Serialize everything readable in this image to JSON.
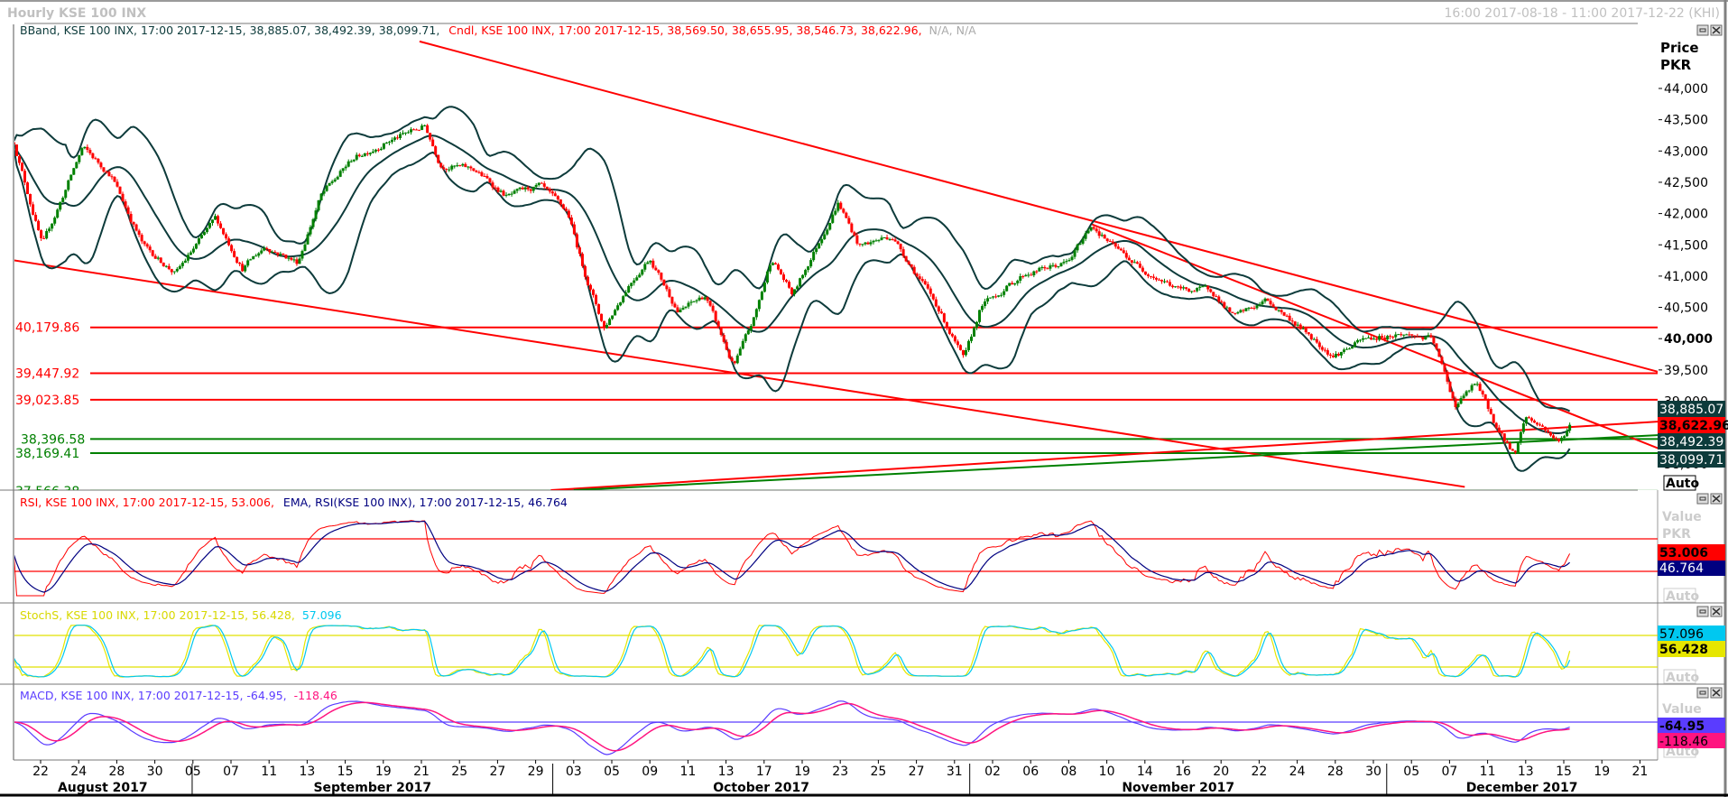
{
  "window": {
    "title": "Hourly KSE 100 INX",
    "range": "16:00 2017-08-18 - 11:00 2017-12-22 (KHI)"
  },
  "main_panel": {
    "legend_bband": "BBand, KSE 100 INX, 17:00 2017-12-15, 38,885.07, 38,492.39, 38,099.71,",
    "legend_cndl": "Cndl, KSE 100 INX, 17:00 2017-12-15, 38,569.50, 38,655.95, 38,546.73, 38,622.96,",
    "legend_na": "N/A, N/A",
    "axis_title": "Price",
    "axis_unit": "PKR",
    "auto": "Auto",
    "value_labels": {
      "bb_upper": "38,885.07",
      "close": "38,622.96",
      "bb_mid": "38,492.39",
      "bb_lower": "38,099.71"
    },
    "horizontal_levels": [
      {
        "label": "40,179.86",
        "value": 40179.86,
        "color": "#ff0000"
      },
      {
        "label": "39,447.92",
        "value": 39447.92,
        "color": "#ff0000"
      },
      {
        "label": "39,023.85",
        "value": 39023.85,
        "color": "#ff0000"
      },
      {
        "label": "38,396.58",
        "value": 38396.58,
        "color": "#008000"
      },
      {
        "label": "38,169.41",
        "value": 38169.41,
        "color": "#008000"
      },
      {
        "label": "37,566.38",
        "value": 37566.38,
        "color": "#008000"
      }
    ]
  },
  "rsi_panel": {
    "legend_rsi": "RSI, KSE 100 INX, 17:00 2017-12-15, 53.006,",
    "legend_ema": "EMA, RSI(KSE 100 INX), 17:00 2017-12-15, 46.764",
    "axis_title": "Value",
    "axis_unit": "PKR",
    "rsi_value": "53.006",
    "ema_value": "46.764",
    "auto": "Auto"
  },
  "stoch_panel": {
    "legend_k": "StochS, KSE 100 INX, 17:00 2017-12-15, 56.428,",
    "legend_d": "57.096",
    "d_value": "57.096",
    "k_value": "56.428",
    "auto": "Auto"
  },
  "macd_panel": {
    "legend_macd": "MACD, KSE 100 INX, 17:00 2017-12-15, -64.95,",
    "legend_signal": "-118.46",
    "axis_title": "Value",
    "macd_value": "-64.95",
    "signal_value": "-118.46",
    "auto": "Auto"
  },
  "colors": {
    "up": "#008000",
    "down": "#ff0000",
    "bands": "#0d3b3b",
    "rsi": "#ff0000",
    "rsi_ema": "#000080",
    "stoch_k": "#e6e600",
    "stoch_d": "#00c8f0",
    "macd": "#5a3cff",
    "signal": "#ff1480"
  },
  "chart_data": {
    "type": "candlestick",
    "title": "Hourly KSE 100 INX",
    "x_unit": "trading days from 2017-08-22",
    "ylabel": "Price PKR",
    "ylim": [
      37566,
      44800
    ],
    "yticks": [
      "44,000",
      "43,500",
      "43,000",
      "42,500",
      "42,000",
      "41,500",
      "41,000",
      "40,500",
      "40,000",
      "39,500",
      "39,000",
      "38,500",
      "38,000"
    ],
    "bars_per_day": 7,
    "close_path": [
      [
        -1.4,
        43140
      ],
      [
        0.1,
        41480
      ],
      [
        2.2,
        43055
      ],
      [
        3.7,
        42620
      ],
      [
        5.4,
        41480
      ],
      [
        7.1,
        41040
      ],
      [
        9.2,
        41920
      ],
      [
        10.6,
        41130
      ],
      [
        11.8,
        41480
      ],
      [
        13.5,
        41220
      ],
      [
        14.7,
        42270
      ],
      [
        16.4,
        42880
      ],
      [
        18.1,
        43140
      ],
      [
        20.2,
        43400
      ],
      [
        21.0,
        42790
      ],
      [
        22.8,
        42700
      ],
      [
        24.5,
        42270
      ],
      [
        26.2,
        42440
      ],
      [
        27.7,
        42000
      ],
      [
        28.5,
        41130
      ],
      [
        29.6,
        40170
      ],
      [
        30.9,
        40870
      ],
      [
        32.0,
        41300
      ],
      [
        33.5,
        40430
      ],
      [
        34.9,
        40690
      ],
      [
        36.4,
        39550
      ],
      [
        37.5,
        40340
      ],
      [
        38.4,
        41300
      ],
      [
        39.5,
        40690
      ],
      [
        41.9,
        42180
      ],
      [
        43.0,
        41480
      ],
      [
        44.7,
        41650
      ],
      [
        47.1,
        40520
      ],
      [
        48.5,
        39640
      ],
      [
        49.4,
        40520
      ],
      [
        51.7,
        41040
      ],
      [
        54.0,
        41220
      ],
      [
        55.2,
        41830
      ],
      [
        56.3,
        41480
      ],
      [
        57.8,
        41130
      ],
      [
        59.8,
        40780
      ],
      [
        61.5,
        40780
      ],
      [
        62.7,
        40340
      ],
      [
        64.4,
        40610
      ],
      [
        66.2,
        40170
      ],
      [
        67.9,
        39730
      ],
      [
        69.6,
        39990
      ],
      [
        71.4,
        40080
      ],
      [
        73.1,
        39990
      ],
      [
        74.3,
        38940
      ],
      [
        75.4,
        39290
      ],
      [
        76.6,
        38500
      ],
      [
        77.4,
        38150
      ],
      [
        78.0,
        38760
      ],
      [
        78.9,
        38590
      ],
      [
        79.8,
        38330
      ],
      [
        80.3,
        38622.96
      ]
    ],
    "trendlines": [
      {
        "color": "#ff0000",
        "from": [
          19.9,
          44752
        ],
        "to": [
          85.0,
          39467
        ]
      },
      {
        "color": "#ff0000",
        "from": [
          -1.4,
          41252
        ],
        "to": [
          74.8,
          37630
        ]
      },
      {
        "color": "#ff0000",
        "from": [
          55.2,
          41830
        ],
        "to": [
          85.0,
          38242
        ]
      },
      {
        "color": "#ff0000",
        "from": [
          26.8,
          37578
        ],
        "to": [
          85.0,
          38675
        ]
      },
      {
        "color": "#008000",
        "from": [
          28.0,
          37578
        ],
        "to": [
          85.0,
          38459
        ]
      }
    ],
    "x_tick_labels": [
      "22",
      "24",
      "28",
      "30",
      "05",
      "07",
      "11",
      "13",
      "15",
      "19",
      "21",
      "25",
      "27",
      "29",
      "03",
      "05",
      "09",
      "11",
      "13",
      "17",
      "19",
      "23",
      "25",
      "27",
      "31",
      "02",
      "06",
      "08",
      "10",
      "14",
      "16",
      "20",
      "22",
      "24",
      "28",
      "30",
      "05",
      "07",
      "11",
      "13",
      "15",
      "19",
      "21"
    ],
    "months": [
      {
        "label": "August 2017",
        "start": -1.44,
        "end": 7.96
      },
      {
        "label": "September 2017",
        "start": 7.96,
        "end": 26.9
      },
      {
        "label": "October 2017",
        "start": 26.9,
        "end": 48.8
      },
      {
        "label": "November 2017",
        "start": 48.8,
        "end": 70.7
      },
      {
        "label": "December 2017",
        "start": 70.7,
        "end": 84.9
      }
    ],
    "indicators": {
      "bollinger": {
        "period": 20,
        "stdev": 2,
        "last": [
          38885.07,
          38492.39,
          38099.71
        ]
      },
      "rsi": {
        "period": 14,
        "levels": [
          70,
          30
        ],
        "last": 53.006,
        "ema_last": 46.764
      },
      "stochastic": {
        "levels": [
          80,
          20
        ],
        "last_k": 56.428,
        "last_d": 57.096
      },
      "macd": {
        "fast": 12,
        "slow": 26,
        "signal": 9,
        "last": -64.95,
        "signal_last": -118.46
      }
    }
  }
}
